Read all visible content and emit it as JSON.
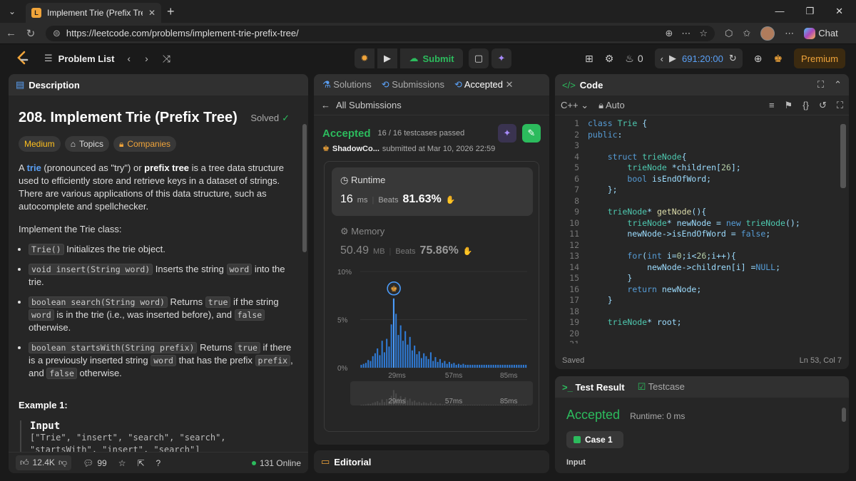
{
  "browser": {
    "tab_title": "Implement Trie (Prefix Tree) - Leet",
    "url": "https://leetcode.com/problems/implement-trie-prefix-tree/",
    "chat_label": "Chat"
  },
  "header": {
    "problem_list": "Problem List",
    "submit_label": "Submit",
    "streak": "0",
    "timer": "691:20:00",
    "premium": "Premium"
  },
  "description": {
    "tab_label": "Description",
    "title": "208. Implement Trie (Prefix Tree)",
    "solved": "Solved",
    "tags": [
      "Medium",
      "Topics",
      "Companies"
    ],
    "intro": {
      "p1": "A ",
      "trie": "trie",
      "p2": " (pronounced as \"try\") or ",
      "prefix_tree": "prefix tree",
      "p3": " is a tree data structure used to efficiently store and retrieve keys in a dataset of strings. There are various applications of this data structure, such as autocomplete and spellchecker."
    },
    "implement": "Implement the Trie class:",
    "bullets": [
      {
        "code": "Trie()",
        "text": " Initializes the trie object."
      },
      {
        "code": "void insert(String word)",
        "text": " Inserts the string ",
        "code2": "word",
        "text2": " into the trie."
      },
      {
        "code": "boolean search(String word)",
        "text": " Returns ",
        "code2": "true",
        "text2": " if the string ",
        "code3": "word",
        "text3": " is in the trie (i.e., was inserted before), and ",
        "code4": "false",
        "text4": " otherwise."
      },
      {
        "code": "boolean startsWith(String prefix)",
        "text": " Returns ",
        "code2": "true",
        "text2": " if there is a previously inserted string ",
        "code3": "word",
        "text3": " that has the prefix ",
        "code4": "prefix",
        "text4": ", and ",
        "code5": "false",
        "text5": " otherwise."
      }
    ],
    "example_title": "Example 1:",
    "input_label": "Input",
    "input_line1": "[\"Trie\", \"insert\", \"search\", \"search\",",
    "input_line2": "\"startsWith\", \"insert\", \"search\"]",
    "likes": "12.4K",
    "comments": "99",
    "online": "131 Online"
  },
  "submission": {
    "tabs": [
      "Solutions",
      "Submissions",
      "Accepted"
    ],
    "all_submissions": "All Submissions",
    "status": "Accepted",
    "passed": "16 / 16 testcases passed",
    "user": "ShadowCo...",
    "submitted_at": "submitted at Mar 10, 2026 22:59",
    "runtime_label": "Runtime",
    "runtime_value": "16",
    "runtime_unit": "ms",
    "runtime_beats_label": "Beats",
    "runtime_beats": "81.63%",
    "memory_label": "Memory",
    "memory_value": "50.49",
    "memory_unit": "MB",
    "memory_beats_label": "Beats",
    "memory_beats": "75.86%"
  },
  "chart_data": {
    "type": "bar",
    "ytick_labels": [
      "10%",
      "5%",
      "0%"
    ],
    "xtick_labels": [
      "29ms",
      "57ms",
      "85ms"
    ],
    "ylim": [
      0,
      10
    ],
    "user_bar_index": 14,
    "values": [
      0.3,
      0.4,
      0.5,
      0.8,
      0.7,
      1.2,
      1.5,
      2.0,
      1.3,
      2.8,
      1.6,
      3.0,
      2.2,
      4.5,
      7.2,
      5.6,
      3.4,
      4.4,
      2.8,
      3.8,
      2.4,
      3.2,
      1.8,
      2.3,
      1.4,
      1.7,
      1.0,
      1.5,
      1.2,
      0.9,
      1.6,
      0.7,
      1.1,
      0.6,
      0.9,
      0.5,
      0.7,
      0.4,
      0.6,
      0.4,
      0.5,
      0.3,
      0.4,
      0.3,
      0.4,
      0.3,
      0.3,
      0.3,
      0.3,
      0.3,
      0.3,
      0.3,
      0.3,
      0.3,
      0.3,
      0.3,
      0.3,
      0.3,
      0.3,
      0.3,
      0.3,
      0.3,
      0.3,
      0.3,
      0.3,
      0.3,
      0.3,
      0.3,
      0.3,
      0.3,
      0.3,
      0.3
    ]
  },
  "editorial": "Editorial",
  "code": {
    "tab_label": "Code",
    "language": "C++",
    "auto": "Auto",
    "saved": "Saved",
    "position": "Ln 53, Col 7",
    "lines": [
      {
        "n": "1",
        "t": "class Trie {"
      },
      {
        "n": "2",
        "t": "public:"
      },
      {
        "n": "3",
        "t": ""
      },
      {
        "n": "4",
        "t": "    struct trieNode{"
      },
      {
        "n": "5",
        "t": "        trieNode *children[26];"
      },
      {
        "n": "6",
        "t": "        bool isEndOfWord;"
      },
      {
        "n": "7",
        "t": "    };"
      },
      {
        "n": "8",
        "t": ""
      },
      {
        "n": "9",
        "t": "    trieNode* getNode(){"
      },
      {
        "n": "10",
        "t": "        trieNode* newNode = new trieNode();"
      },
      {
        "n": "11",
        "t": "        newNode->isEndOfWord = false;"
      },
      {
        "n": "12",
        "t": ""
      },
      {
        "n": "13",
        "t": "        for(int i=0;i<26;i++){"
      },
      {
        "n": "14",
        "t": "            newNode->children[i] =NULL;"
      },
      {
        "n": "15",
        "t": "        }"
      },
      {
        "n": "16",
        "t": "        return newNode;"
      },
      {
        "n": "17",
        "t": "    }"
      },
      {
        "n": "18",
        "t": ""
      },
      {
        "n": "19",
        "t": "    trieNode* root;"
      },
      {
        "n": "20",
        "t": ""
      },
      {
        "n": "21",
        "t": ""
      }
    ]
  },
  "test": {
    "tab_result": "Test Result",
    "tab_case": "Testcase",
    "status": "Accepted",
    "runtime": "Runtime: 0 ms",
    "case": "Case 1",
    "input": "Input"
  }
}
